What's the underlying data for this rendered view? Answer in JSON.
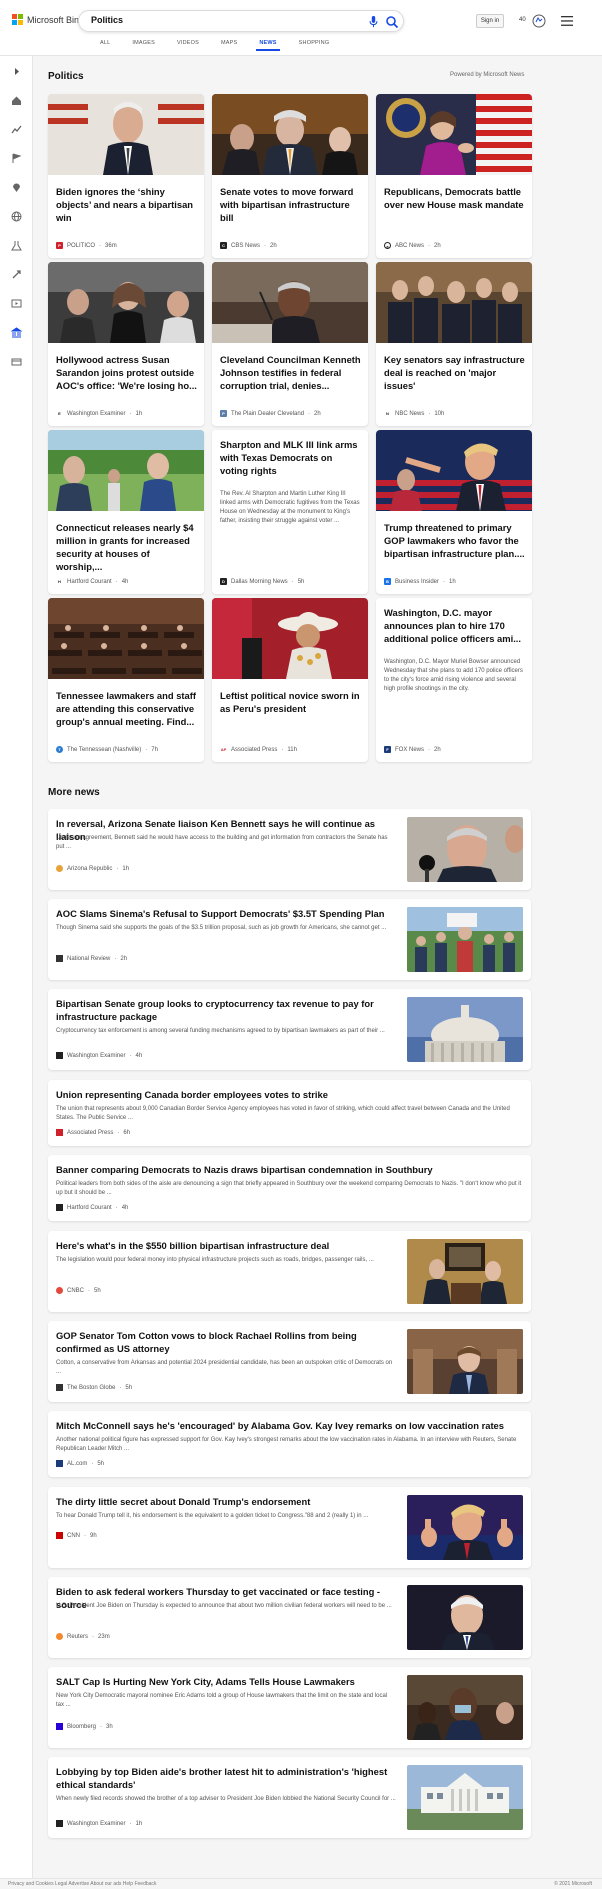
{
  "header": {
    "logo_text": "Microsoft Bing",
    "search_value": "Politics",
    "signin_label": "Sign in",
    "points": "40"
  },
  "tabs": [
    {
      "label": "ALL",
      "active": false
    },
    {
      "label": "IMAGES",
      "active": false
    },
    {
      "label": "VIDEOS",
      "active": false
    },
    {
      "label": "MAPS",
      "active": false
    },
    {
      "label": "NEWS",
      "active": true
    },
    {
      "label": "SHOPPING",
      "active": false
    }
  ],
  "section": {
    "title": "Politics",
    "powered_by": "Powered by Microsoft News"
  },
  "cards": [
    {
      "title": "Biden ignores the ‘shiny objects’ and nears a bipartisan win",
      "source": "POLITICO",
      "age": "36m",
      "badge_color": "#d1202a",
      "badge_text": "P"
    },
    {
      "title": "Senate votes to move forward with bipartisan infrastructure bill",
      "source": "CBS News",
      "age": "2h",
      "badge_color": "#222222",
      "badge_text": "C"
    },
    {
      "title": "Republicans, Democrats battle over new House mask mandate",
      "source": "ABC News",
      "age": "2h",
      "badge_color": "#ffffff",
      "badge_text": "a"
    },
    {
      "title": "Hollywood actress Susan Sarandon joins protest outside AOC's office: 'We're losing ho...",
      "source": "Washington Examiner",
      "age": "1h",
      "badge_color": "#ffffff",
      "badge_text": "E"
    },
    {
      "title": "Cleveland Councilman Kenneth Johnson testifies in federal corruption trial, denies...",
      "source": "The Plain Dealer Cleveland",
      "age": "2h",
      "badge_color": "#5b7fa8",
      "badge_text": "P"
    },
    {
      "title": "Key senators say infrastructure deal is reached on 'major issues'",
      "source": "NBC News",
      "age": "10h",
      "badge_color": "#ffffff",
      "badge_text": "N"
    },
    {
      "title": "Connecticut releases nearly $4 million in grants for increased security at houses of worship,...",
      "source": "Hartford Courant",
      "age": "4h",
      "badge_color": "#ffffff",
      "badge_text": "H"
    },
    {
      "title": "Sharpton and MLK III link arms with Texas Democrats on voting rights",
      "snippet": "The Rev. Al Sharpton and Martin Luther King III linked arms with Democratic fugitives from the Texas House on Wednesday at the monument to King's father, insisting their struggle against voter ...",
      "source": "Dallas Morning News",
      "age": "5h",
      "badge_color": "#222222",
      "badge_text": "D"
    },
    {
      "title": "Trump threatened to primary GOP lawmakers who favor the bipartisan infrastructure plan....",
      "source": "Business Insider",
      "age": "1h",
      "badge_color": "#1a73e8",
      "badge_text": "B"
    },
    {
      "title": "Tennessee lawmakers and staff are attending this conservative group's annual meeting. Find...",
      "source": "The Tennessean (Nashville)",
      "age": "7h",
      "badge_color": "#2b7dd1",
      "badge_text": "T"
    },
    {
      "title": "Leftist political novice sworn in as Peru's president",
      "source": "Associated Press",
      "age": "11h",
      "badge_color": "#ffffff",
      "badge_text": "AP"
    },
    {
      "title": "Washington, D.C. mayor announces plan to hire 170 additional police officers ami...",
      "snippet": "Washington, D.C. Mayor Muriel Bowser announced Wednesday that she plans to add 170 police officers to the city's force amid rising violence and several high profile shootings in the city.",
      "source": "FOX News",
      "age": "2h",
      "badge_color": "#1c3b7a",
      "badge_text": "F"
    }
  ],
  "more_news": {
    "title": "More news",
    "items": [
      {
        "title": "In reversal, Arizona Senate liaison Ken Bennett says he will continue as liaison",
        "snippet": "Under an agreement, Bennett said he would have access to the building and get information from contractors the Senate has put ...",
        "source": "Arizona Republic",
        "age": "1h",
        "badge_color": "#e7a23a"
      },
      {
        "title": "AOC Slams Sinema's Refusal to Support Democrats' $3.5T Spending Plan",
        "snippet": "Though Sinema said she supports the goals of the $3.5 trillion proposal, such as job growth for Americans, she cannot get ...",
        "source": "National Review",
        "age": "2h",
        "badge_color": "#333333"
      },
      {
        "title": "Bipartisan Senate group looks to cryptocurrency tax revenue to pay for infrastructure package",
        "snippet": "Cryptocurrency tax enforcement is among several funding mechanisms agreed to by bipartisan lawmakers as part of their ...",
        "source": "Washington Examiner",
        "age": "4h",
        "badge_color": "#222222"
      },
      {
        "title": "Union representing Canada border employees votes to strike",
        "snippet": "The union that represents about 9,000 Canadian Border Service Agency employees has voted in favor of striking, which could affect travel between Canada and the United States. The Public Service ...",
        "source": "Associated Press",
        "age": "6h",
        "badge_color": "#d1202a"
      },
      {
        "title": "Banner comparing Democrats to Nazis draws bipartisan condemnation in Southbury",
        "snippet": "Political leaders from both sides of the aisle are denouncing a sign that briefly appeared in Southbury over the weekend comparing Democrats to Nazis. \"I don't know who put it up but it should be ...",
        "source": "Hartford Courant",
        "age": "4h",
        "badge_color": "#222222"
      },
      {
        "title": "Here's what's in the $550 billion bipartisan infrastructure deal",
        "snippet": "The legislation would pour federal money into physical infrastructure projects such as roads, bridges, passenger rails, ...",
        "source": "CNBC",
        "age": "5h",
        "badge_color": "#e24b3b"
      },
      {
        "title": "GOP Senator Tom Cotton vows to block Rachael Rollins from being confirmed as US attorney",
        "snippet": "Cotton, a conservative from Arkansas and potential 2024 presidential candidate, has been an outspoken critic of Democrats on ...",
        "source": "The Boston Globe",
        "age": "5h",
        "badge_color": "#333333"
      },
      {
        "title": "Mitch McConnell says he's 'encouraged' by Alabama Gov. Kay Ivey remarks on low vaccination rates",
        "snippet": "Another national political figure has expressed support for Gov. Kay Ivey's strongest remarks about the low vaccination rates in Alabama. In an interview with Reuters, Senate Republican Leader Mitch ...",
        "source": "AL.com",
        "age": "5h",
        "badge_color": "#1c3b7a"
      },
      {
        "title": "The dirty little secret about Donald Trump's endorsement",
        "snippet": "To hear Donald Trump tell it, his endorsement is the equivalent to a golden ticket to Congress.\"88 and 2 (really 1) in ...",
        "source": "CNN",
        "age": "9h",
        "badge_color": "#cc0000"
      },
      {
        "title": "Biden to ask federal workers Thursday to get vaccinated or face testing -source",
        "snippet": "U.S. President Joe Biden on Thursday is expected to announce that about two million civilian federal workers will need to be ...",
        "source": "Reuters",
        "age": "23m",
        "badge_color": "#f28a2e"
      },
      {
        "title": "SALT Cap Is Hurting New York City, Adams Tells House Lawmakers",
        "snippet": "New York City Democratic mayoral nominee Eric Adams told a group of House lawmakers that the limit on the state and local tax ...",
        "source": "Bloomberg",
        "age": "3h",
        "badge_color": "#2800d7"
      },
      {
        "title": "Lobbying by top Biden aide's brother latest hit to administration's 'highest ethical standards'",
        "snippet": "When newly filed records showed the brother of a top adviser to President Joe Biden lobbied the National Security Council for ...",
        "source": "Washington Examiner",
        "age": "1h",
        "badge_color": "#222222"
      }
    ]
  },
  "footer": {
    "left": "Privacy and Cookies  Legal  Advertise  About our ads  Help  Feedback",
    "right": "© 2021 Microsoft"
  }
}
